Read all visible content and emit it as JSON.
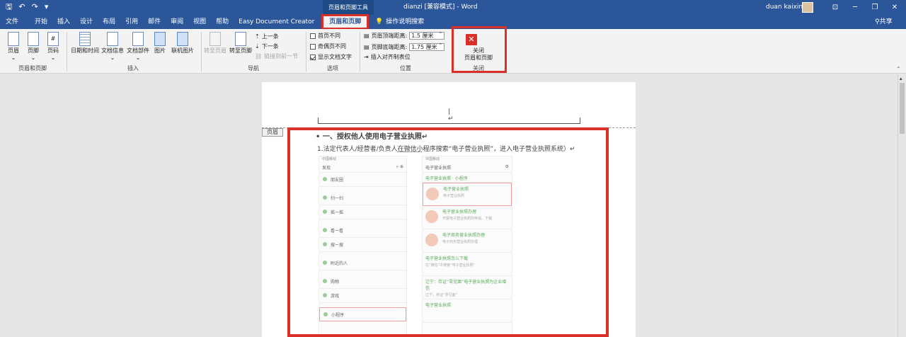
{
  "titlebar": {
    "qat": [
      "save-icon",
      "undo-icon",
      "redo-icon",
      "customize-icon"
    ],
    "context_tab_header": "页眉和页脚工具",
    "document_title": "dianzi [兼容模式] - Word",
    "user_name": "duan kaixin",
    "window_buttons": [
      "ribbon-display-icon",
      "minimize-icon",
      "restore-icon",
      "close-icon"
    ]
  },
  "tabs": [
    {
      "label": "文件"
    },
    {
      "label": "开始"
    },
    {
      "label": "插入"
    },
    {
      "label": "设计"
    },
    {
      "label": "布局"
    },
    {
      "label": "引用"
    },
    {
      "label": "邮件"
    },
    {
      "label": "审阅"
    },
    {
      "label": "视图"
    },
    {
      "label": "帮助"
    },
    {
      "label": "Easy Document Creator"
    },
    {
      "label": "页眉和页脚",
      "active": true
    }
  ],
  "tell_me": "操作说明搜索",
  "share": "共享",
  "ribbon": {
    "groups": {
      "header_footer": {
        "label": "页眉和页脚",
        "buttons": [
          "页眉",
          "页脚",
          "页码"
        ]
      },
      "insert": {
        "label": "插入",
        "buttons": [
          "日期和时间",
          "文档信息",
          "文档部件",
          "图片",
          "联机图片"
        ]
      },
      "navigation": {
        "label": "导航",
        "goto_header": "转至页眉",
        "goto_footer": "转至页脚",
        "prev": "上一条",
        "next": "下一条",
        "link_prev": "链接到前一节"
      },
      "options": {
        "label": "选项",
        "diff_first": "首页不同",
        "diff_odd_even": "奇偶页不同",
        "show_text": "显示文档文字"
      },
      "position": {
        "label": "位置",
        "header_top_label": "页眉顶端距离:",
        "header_top_value": "1.5 厘米",
        "footer_bottom_label": "页脚底端距离:",
        "footer_bottom_value": "1.75 厘米",
        "insert_tab": "插入对齐制表位"
      },
      "close": {
        "label": "关闭",
        "button_line1": "关闭",
        "button_line2": "页眉和页脚"
      }
    }
  },
  "document": {
    "header_tag": "页眉",
    "heading": "• 一、授权他人使用电子营业执照↵",
    "para_before": "1.法定代表人/经营者/负责人",
    "para_link": "在微信小",
    "para_after": "程序搜索“电子营业执照”，进入电子营业执照系统）↵",
    "phone_left": {
      "status": "中国移动",
      "title": "发现",
      "items": [
        "朋友圈",
        "扫一扫",
        "摇一摇",
        "看一看",
        "搜一搜",
        "附近的人",
        "购物",
        "游戏",
        "小程序"
      ]
    },
    "phone_right": {
      "status": "中国移动",
      "title": "电子营业执照",
      "section": "电子营业执照 · 小程序",
      "results": [
        {
          "title": "电子营业执照",
          "desc": "电子营业执照"
        },
        {
          "title": "电子营业执照办理",
          "desc": "开展电子营业执照的申请、下载"
        },
        {
          "title": "电子商务营业执照办理",
          "desc": "电子商务营业执照办理"
        },
        {
          "title": "电子营业执照怎么下载",
          "desc": "在“微信”中搜索“电子营业执照”"
        },
        {
          "title": "辽宁：存证“零见面”电子营业执照为企业增信",
          "desc": "辽宁，存证“零见面”"
        },
        {
          "title": "电子营业执照",
          "desc": ""
        }
      ]
    }
  }
}
